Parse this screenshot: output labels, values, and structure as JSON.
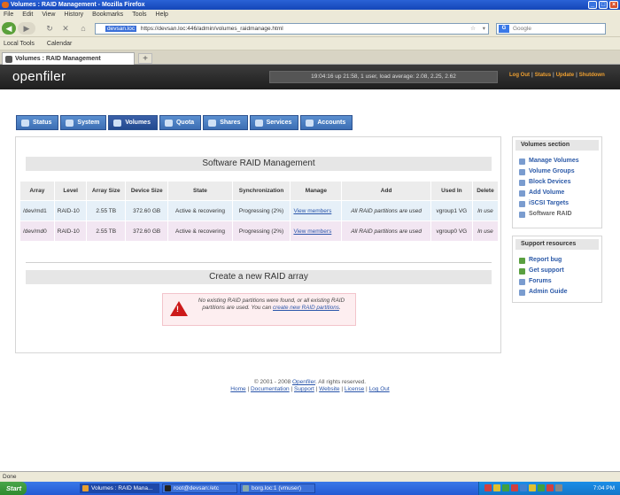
{
  "window": {
    "title": "Volumes : RAID Management - Mozilla Firefox",
    "controls": [
      "_",
      "□",
      "×"
    ]
  },
  "menubar": [
    "File",
    "Edit",
    "View",
    "History",
    "Bookmarks",
    "Tools",
    "Help"
  ],
  "navbar": {
    "site_badge": "devsan.loc",
    "url": "https://devsan.loc:446/admin/volumes_raidmanage.html",
    "search_placeholder": "Google",
    "search_engine_icon": "G"
  },
  "bookmarks": [
    "Local Tools",
    "Calendar"
  ],
  "tab": {
    "title": "Volumes : RAID Management",
    "new_tab": "+"
  },
  "openfiler": {
    "logo": "openfiler",
    "status": "19:04:16 up 21:58, 1 user, load average: 2.08, 2.25, 2.62",
    "links": [
      "Log Out",
      "Status",
      "Update",
      "Shutdown"
    ],
    "separator": "|",
    "tabs": [
      "Status",
      "System",
      "Volumes",
      "Quota",
      "Shares",
      "Services",
      "Accounts"
    ],
    "active_tab": "Volumes"
  },
  "main": {
    "title": "Software RAID Management",
    "table": {
      "headers": [
        "Array",
        "Level",
        "Array Size",
        "Device Size",
        "State",
        "Synchronization",
        "Manage",
        "Add",
        "Used In",
        "Delete"
      ],
      "rows": [
        {
          "array": "/dev/md1",
          "level": "RAID-10",
          "array_size": "2.55 TB",
          "device_size": "372.60 GB",
          "state": "Active & recovering",
          "sync": "Progressing (2%)",
          "manage": "View members",
          "add": "All RAID partitions are used",
          "used_in": "vgroup1 VG",
          "delete": "In use"
        },
        {
          "array": "/dev/md0",
          "level": "RAID-10",
          "array_size": "2.55 TB",
          "device_size": "372.60 GB",
          "state": "Active & recovering",
          "sync": "Progressing (2%)",
          "manage": "View members",
          "add": "All RAID partitions are used",
          "used_in": "vgroup0 VG",
          "delete": "In use"
        }
      ]
    },
    "create_title": "Create a new RAID array",
    "warning": {
      "text": "No existing RAID partitions were found, or all existing RAID partitions are used. You can",
      "link": "create new RAID partitions",
      "end": "."
    }
  },
  "sidebar": {
    "volumes_section": {
      "title": "Volumes section",
      "items": [
        "Manage Volumes",
        "Volume Groups",
        "Block Devices",
        "Add Volume",
        "iSCSI Targets",
        "Software RAID"
      ]
    },
    "support": {
      "title": "Support resources",
      "items": [
        "Report bug",
        "Get support",
        "Forums",
        "Admin Guide"
      ]
    }
  },
  "footer": {
    "copyright_prefix": "© 2001 - 2008",
    "brand": "Openfiler",
    "copyright_suffix": ". All rights reserved.",
    "links": [
      "Home",
      "Documentation",
      "Support",
      "Website",
      "License",
      "Log Out"
    ],
    "separator": "|"
  },
  "statusbar": "Done",
  "taskbar": {
    "start": "Start",
    "tasks": [
      "Volumes : RAID Mana...",
      "root@devsan:/etc",
      "borg.loc:1 (vmuser)"
    ],
    "clock": "7:04 PM"
  },
  "colors": {
    "tab_blue": "#4a7fc4",
    "row1": "#e6f0f8",
    "row2": "#f2e6f2",
    "link": "#2a55aa",
    "header_orange": "#f0a030",
    "warning_red": "#cc1a1a"
  }
}
